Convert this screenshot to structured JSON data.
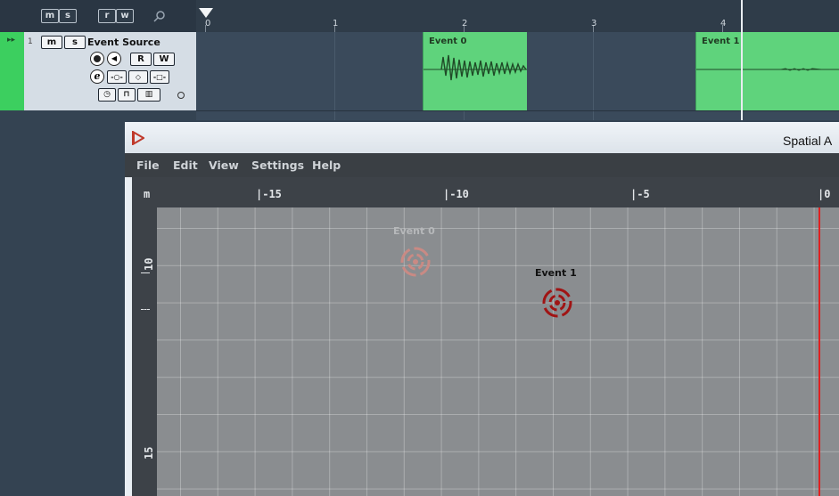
{
  "toolbar": {
    "buttons": [
      "m",
      "s",
      "r",
      "w"
    ],
    "search_icon": "search-icon"
  },
  "ruler": {
    "marks": [
      "0",
      "1",
      "2",
      "3",
      "4"
    ]
  },
  "track": {
    "number": "1",
    "mute": "m",
    "solo": "s",
    "name": "Event Source",
    "read": "R",
    "write": "W",
    "edit": "e",
    "color": "#3ccf5f"
  },
  "events": [
    {
      "label": "Event 0"
    },
    {
      "label": "Event 1"
    }
  ],
  "spatial_window": {
    "title": "Spatial A",
    "menu": [
      "File",
      "Edit",
      "View",
      "Settings",
      "Help"
    ],
    "unit": "m",
    "x_ticks": [
      "|-15",
      "|-10",
      "|-5",
      "|0"
    ],
    "y_ticks": [
      "10",
      "15"
    ],
    "emitters": [
      {
        "label": "Event 0",
        "active": false
      },
      {
        "label": "Event 1",
        "active": true
      }
    ]
  },
  "colors": {
    "event_fill": "#5fd37c",
    "emitter_active": "#a01414",
    "emitter_inactive": "#c98a84",
    "zero_line": "#e02020"
  }
}
